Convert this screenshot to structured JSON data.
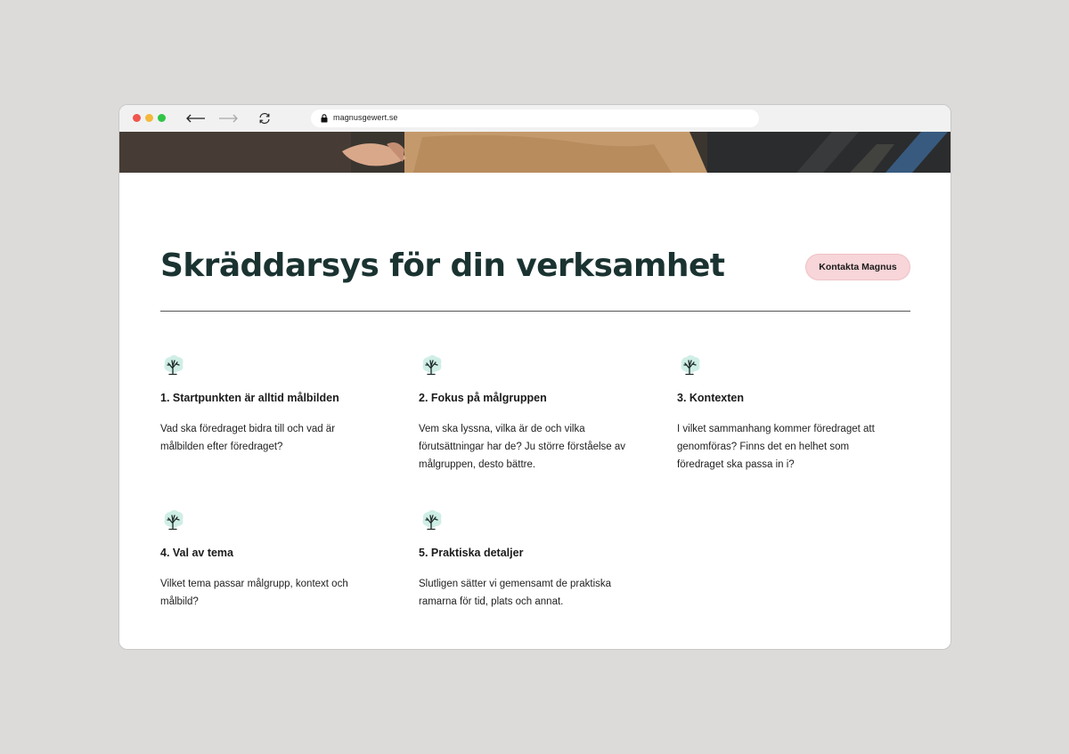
{
  "browser": {
    "url": "magnusgewert.se"
  },
  "page": {
    "heading": "Skräddarsys för din verksamhet",
    "contact_button": "Kontakta Magnus"
  },
  "features": [
    {
      "icon": "tree-icon",
      "title": "1. Startpunkten är alltid målbilden",
      "description": "Vad ska föredraget bidra till och vad är målbilden efter föredraget?"
    },
    {
      "icon": "tree-icon",
      "title": "2. Fokus på målgruppen",
      "description": "Vem ska lyssna, vilka är de och vilka förutsättningar har de? Ju större förståelse av målgruppen, desto bättre."
    },
    {
      "icon": "tree-icon",
      "title": "3. Kontexten",
      "description": "I vilket sammanhang kommer föredraget att genomföras? Finns det en helhet som föredraget ska passa in i?"
    },
    {
      "icon": "tree-icon",
      "title": "4. Val av tema",
      "description": "Vilket tema passar målgrupp, kontext och målbild?"
    },
    {
      "icon": "tree-icon",
      "title": "5. Praktiska detaljer",
      "description": "Slutligen sätter vi gemensamt de praktiska ramarna för tid, plats och annat."
    }
  ],
  "colors": {
    "heading": "#1a3331",
    "button_bg": "#f7d5d8",
    "icon_blob": "#cfeee6",
    "backdrop": "#dcdbd9"
  }
}
